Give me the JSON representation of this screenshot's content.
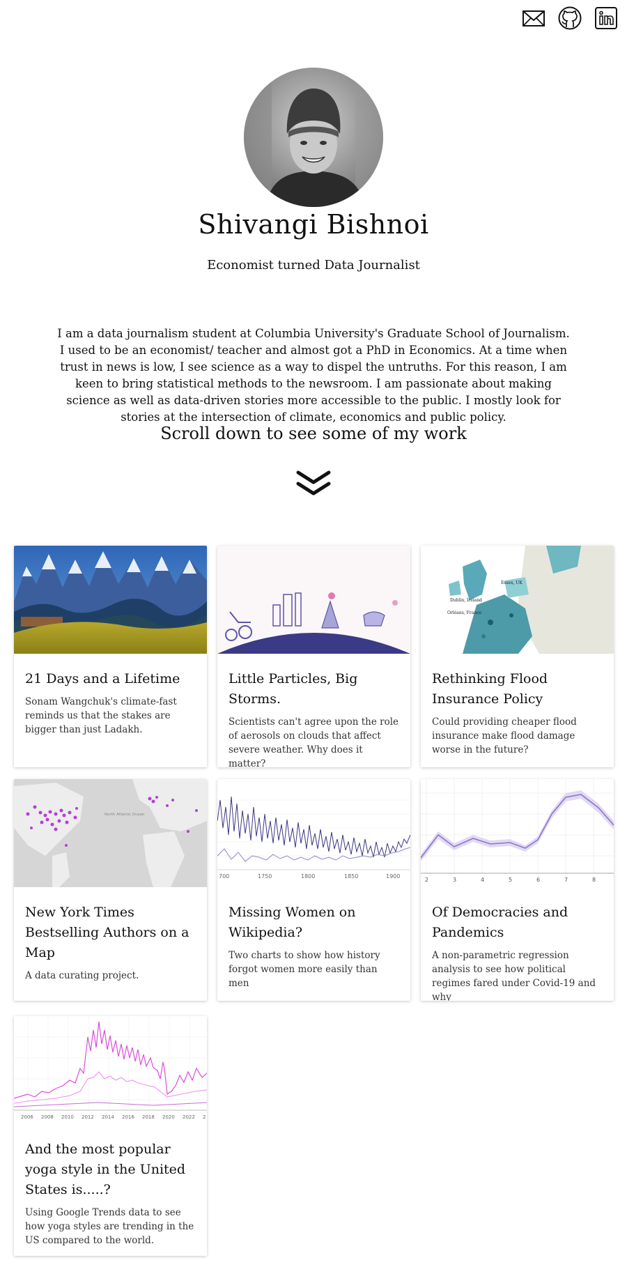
{
  "social": {
    "email": "email-icon",
    "github": "github-icon",
    "linkedin": "linkedin-icon"
  },
  "profile": {
    "name": "Shivangi Bishnoi",
    "tagline": "Economist turned Data Journalist",
    "bio": "I am a data journalism student at Columbia University's Graduate School of Journalism. I used to be an economist/ teacher and almost got a PhD in Economics. At a time when trust in news is low, I see science as a way to dispel the untruths. For this reason, I am keen to bring statistical methods to the newsroom. I am passionate about making science as well as data-driven stories more accessible to the public. I mostly look for stories at the intersection of climate, economics and public policy.",
    "scroll_prompt": "Scroll down to see some of my work"
  },
  "projects": [
    {
      "title": "21 Days and a Lifetime",
      "desc": "Sonam Wangchuk's climate-fast reminds us that the stakes are bigger than just Ladakh."
    },
    {
      "title": "Little Particles, Big Storms.",
      "desc": "Scientists can't agree upon the role of aerosols on clouds that affect severe weather. Why does it matter?"
    },
    {
      "title": "Rethinking Flood Insurance Policy",
      "desc": "Could providing cheaper flood insurance make flood damage worse in the future?"
    },
    {
      "title": "New York Times Bestselling Authors on a Map",
      "desc": "A data curating project."
    },
    {
      "title": "Missing Women on Wikipedia?",
      "desc": "Two charts to show how history forgot women more easily than men"
    },
    {
      "title": "Of Democracies and Pandemics",
      "desc": "A non-parametric regression analysis to see how political regimes fared under Covid-19 and why"
    },
    {
      "title": "And the most popular yoga style in the United States is.....?",
      "desc": "Using Google Trends data to see how yoga styles are trending in the US compared to the world."
    }
  ],
  "thumb_text": {
    "flood_map_label_1": "Essex, UK",
    "flood_map_label_2": "Dublin, Ireland",
    "flood_map_label_3": "Orléans, France",
    "map_label_1": "North Atlantic Ocean",
    "wiki_x_ticks": [
      "700",
      "1750",
      "1800",
      "1850",
      "1900"
    ],
    "dem_x_ticks": [
      "2",
      "3",
      "4",
      "5",
      "6",
      "7",
      "8"
    ],
    "yoga_x_ticks": [
      "2006",
      "2008",
      "2010",
      "2012",
      "2014",
      "2016",
      "2018",
      "2020",
      "2022",
      "2"
    ]
  },
  "colors": {
    "text": "#111111",
    "card_shadow": "#d0d0d0",
    "accent_purple": "#7b5fc4",
    "accent_pink": "#e05ae0"
  }
}
